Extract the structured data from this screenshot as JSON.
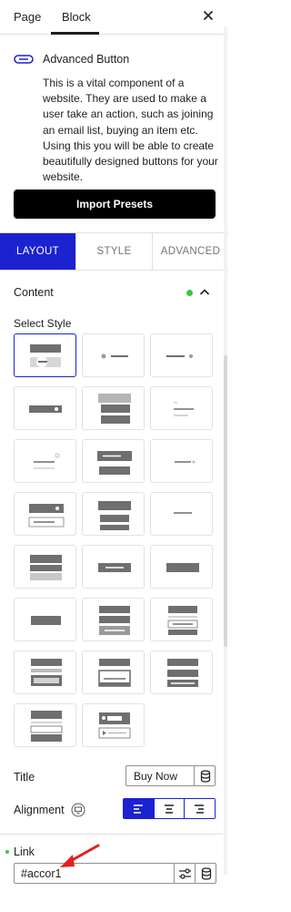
{
  "header": {
    "tab_page": "Page",
    "tab_block": "Block",
    "close_icon": "close-icon"
  },
  "block": {
    "icon": "button-block-icon",
    "title": "Advanced Button",
    "description": "This is a vital component of a website. They are used to make a user take an action, such as joining an email list, buying an item etc. Using this you will be able to create beautifully designed buttons for your website."
  },
  "import_presets": "Import Presets",
  "panel_tabs": [
    {
      "label": "LAYOUT",
      "active": true
    },
    {
      "label": "STYLE",
      "active": false
    },
    {
      "label": "ADVANCED",
      "active": false
    }
  ],
  "content": {
    "label": "Content",
    "status_color": "#2ecc40"
  },
  "select_style": {
    "label": "Select Style",
    "selected_index": 0,
    "count": 23
  },
  "title_field": {
    "label": "Title",
    "value": "Buy Now"
  },
  "alignment": {
    "label": "Alignment",
    "options": [
      "left",
      "center",
      "right"
    ],
    "selected": "left"
  },
  "link": {
    "label": "Link",
    "value": "#accor1"
  },
  "colors": {
    "accent": "#1c22cf",
    "import_bg": "#000000",
    "status": "#2ecc40",
    "annotation_arrow": "#e02020"
  }
}
